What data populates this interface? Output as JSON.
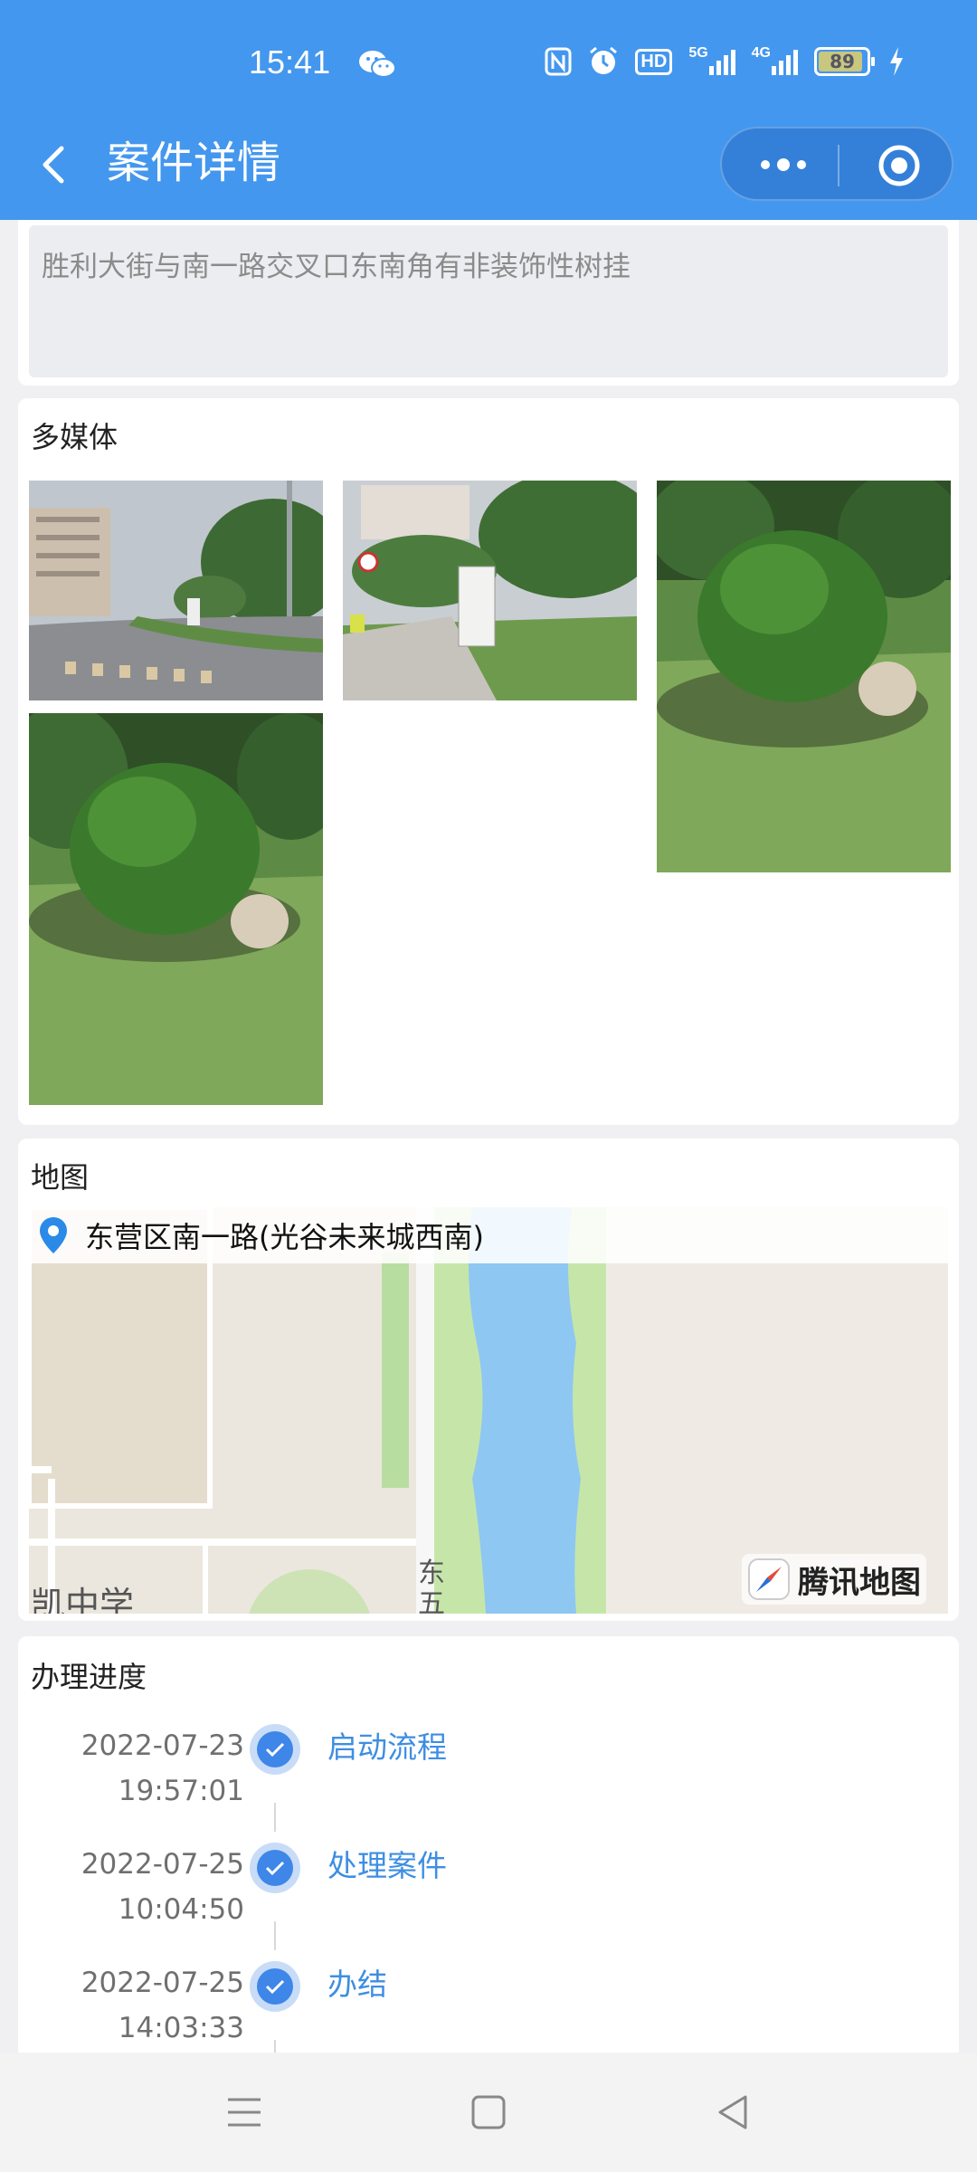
{
  "status_bar": {
    "time": "15:41",
    "battery": "89",
    "hd_label": "HD",
    "net1": "5G",
    "net2": "4G"
  },
  "nav": {
    "title": "案件详情"
  },
  "description": {
    "text": "胜利大街与南一路交叉口东南角有非装饰性树挂"
  },
  "media": {
    "title": "多媒体"
  },
  "map": {
    "title": "地图",
    "address": "东营区南一路(光谷未来城西南)",
    "brand": "腾讯地图",
    "road_label_1": "东",
    "road_label_2": "五",
    "school_label": "凯中学"
  },
  "progress": {
    "title": "办理进度",
    "steps": [
      {
        "date": "2022-07-23",
        "time": "19:57:01",
        "label": "启动流程"
      },
      {
        "date": "2022-07-25",
        "time": "10:04:50",
        "label": "处理案件"
      },
      {
        "date": "2022-07-25",
        "time": "14:03:33",
        "label": "办结"
      }
    ]
  },
  "colors": {
    "accent": "#4497ee",
    "link": "#3e8ee2"
  }
}
